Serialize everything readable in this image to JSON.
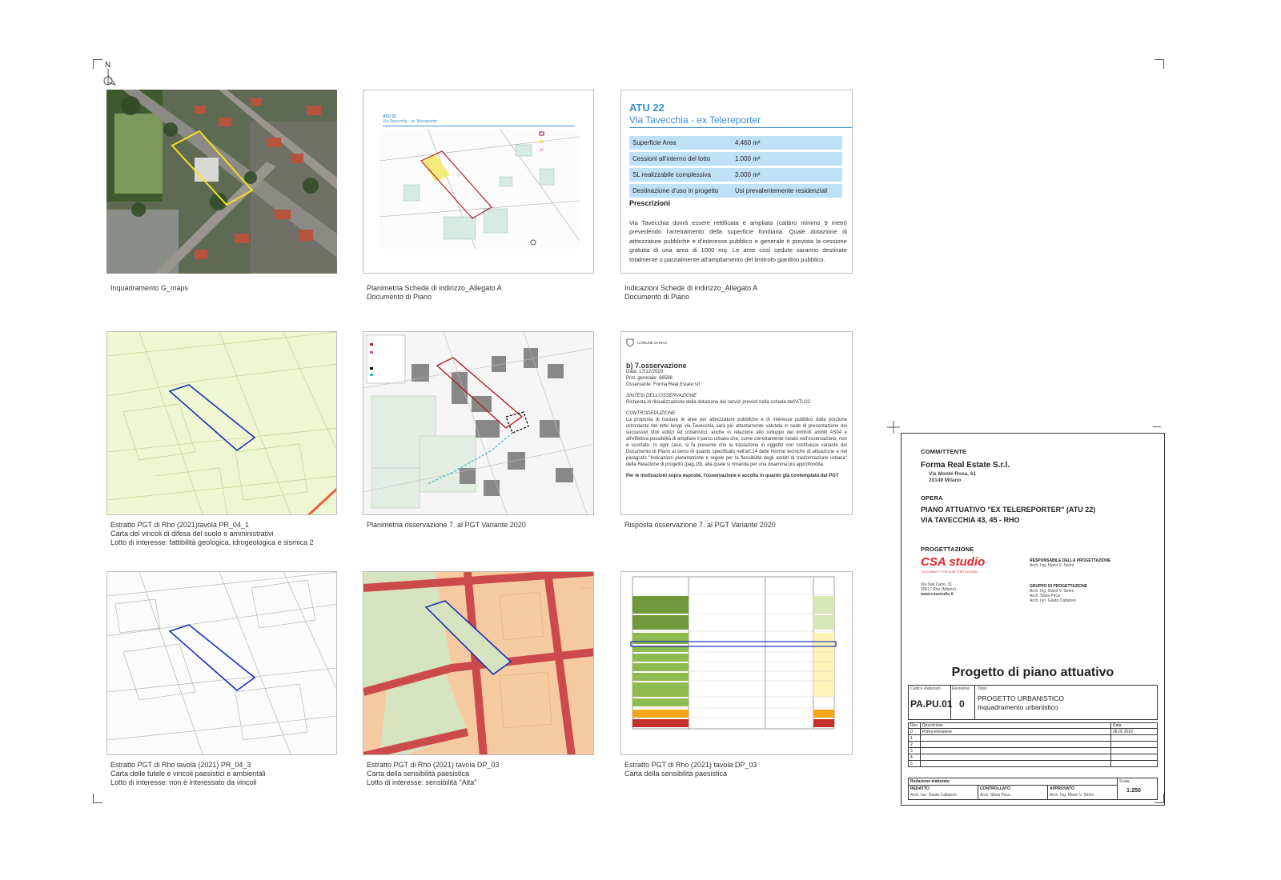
{
  "north": {
    "label": "N"
  },
  "captions": {
    "c1": [
      "Inquadramento G_maps"
    ],
    "c2": [
      "Planimetria Schede di indirizzo_Allegato A",
      "Documento di Piano"
    ],
    "c3": [
      "Indicazioni Schede di indirizzo_Allegato A",
      "Documento di Piano"
    ],
    "c4": [
      "Estratto PGT di Rho (2021)tavola PR_04_1",
      "Carta dei vincoli di difesa del suolo e amministrativi",
      "Lotto di interesse: fattibilità geologica, idrogeologica e sismica 2"
    ],
    "c5": [
      "Planimetria osservazione 7. al PGT Variante 2020"
    ],
    "c6": [
      "Risposta osservazione 7. al PGT Variante 2020"
    ],
    "c7": [
      "Estratto PGT di Rho tavola (2021) PR_04_3",
      "Carta delle tutele e vincoli paesistici e ambientali",
      "Lotto di interesse: non è interessato da vincoli"
    ],
    "c8": [
      "Estratto PGT di Rho (2021) tavola DP_03",
      "Carta della sensibilità paesistica",
      "Lotto di interesse: sensibilità \"Alta\""
    ],
    "c9": [
      "Estratto PGT di Rho (2021) tavola DP_03",
      "Carta della sensibilità paesistica"
    ]
  },
  "atu": {
    "title": "ATU 22",
    "subtitle": "Via Tavecchia - ex Telereporter",
    "rows": [
      {
        "k": "Superficie Area",
        "v": "4.460 m²"
      },
      {
        "k": "Cessioni all'interno del lotto",
        "v": "1.000 m²"
      },
      {
        "k": "SL realizzabile complessiva",
        "v": "3.000 m²"
      },
      {
        "k": "Destinazione d'uso in progetto",
        "v": "Usi prevalentemente residenziali"
      }
    ],
    "prescrizioni_title": "Prescrizioni",
    "prescrizioni_text": "Via Tavecchia dovrà essere rettificata e ampliata (calibro minimo 9 metri) prevedendo l'arretramento della superficie fondiaria. Quale dotazione di attrezzature pubbliche e d'interesse pubblico e generale è prevista la cessione gratuita di una area di 1000 mq. Le aree così cedute saranno destinate totalmente o parzialmente all'ampliamento del limitrofo giardino pubblico."
  },
  "plan_mini": {
    "title": "ATU 22",
    "subtitle": "Via Tavecchia - ex Telereporter"
  },
  "observation": {
    "municipality": "COMUNE DI RHO",
    "title": "b) 7.osservazione",
    "meta": [
      "Data: 17/12/2020",
      "Prot. generale: 68588",
      "Osservante: Forma Real Estate srl"
    ],
    "sintesi_label": "SINTESI DELL'OSSERVAZIONE",
    "sintesi_text": "Richiesta di rilocalizzazione della dotazione dei servizi previsti nella scheda dell'ATU22",
    "contro_label": "CONTRODEDUZIONE",
    "contro_text": "La proposta di traslare le aree per attrezzature pubbliche e di interesse pubblico dalla porzione retrostante del lotto lungo via Tavecchia sarà più attentamente valutata in sede di presentazione dei successivi titoli edilizi ed urbanistici, anche in relazione allo sviluppo dei limitrofi ambiti AS04 e all'effettiva possibilità di ampliare il parco urbano che, come correttamente notato nell'osservazione, non è scontato. In ogni caso, si fa presente che la traslazione in oggetto non costituisce variante del Documento di Piano ai sensi di quanto specificato nell'art.14 delle Norme tecniche di attuazione e nel paragrafo \"Indicazioni planimetriche e regole per la flessibilità degli ambiti di trasformazione urbana\" della Relazione di progetto (pag.19), alla quale si rimanda per una disamina più approfondita.",
    "conclusion": "Per le motivazioni sopra esposte, l'osservazione è accolta in quanto già contemplata dal PGT"
  },
  "title_block": {
    "committente_label": "COMMITTENTE",
    "client_name": "Forma Real Estate S.r.l.",
    "client_addr1": "Via Monte Rosa, 61",
    "client_addr2": "20149 Milano",
    "opera_label": "OPERA",
    "opera_line1": "PIANO ATTUATIVO \"EX TELEREPORTER\" (ATU 22)",
    "opera_line2": "VIA TAVECCHIA 43, 45 - RHO",
    "progettazione_label": "PROGETTAZIONE",
    "studio_logo": "CSA studio",
    "studio_tagline": "ACCURACY FOR A BETTER DESIGN",
    "studio_addr1": "Via San Carlo, 31",
    "studio_addr2": "20017 Rho (Milano)",
    "studio_web": "www.csastudio.it",
    "resp_label": "RESPONSABILE DELLA PROGETTAZIONE",
    "resp_name": "Arch. Ing. Mario V. Serini",
    "gruppo_label": "GRUPPO DI PROGETTAZIONE",
    "gruppo_names": [
      "Arch. Ing. Mario V. Serini",
      "Arch. Silvia Peca",
      "Arch. Iun. Giada Cattaneo"
    ],
    "main_title": "Progetto di piano attuativo",
    "codice_label": "Codice elaborato",
    "revisione_label": "Revisione",
    "titolo_label": "Titolo",
    "codice": "PA.PU.01",
    "revisione": "0",
    "titolo1": "PROGETTO URBANISTICO",
    "titolo2": "Inquadramento urbanistico",
    "rev_header": {
      "rev": "Rev.",
      "desc": "Descrizione",
      "date": "Data"
    },
    "revs": [
      {
        "n": "0",
        "d": "Prima emissione",
        "date": "28.02.2022"
      },
      {
        "n": "1",
        "d": "",
        "date": ""
      },
      {
        "n": "2",
        "d": "",
        "date": ""
      },
      {
        "n": "3",
        "d": "",
        "date": ""
      },
      {
        "n": "4",
        "d": "",
        "date": ""
      },
      {
        "n": "5",
        "d": "",
        "date": ""
      }
    ],
    "redazione_label": "Redazione elaborato",
    "scala_label": "Scala",
    "redatto_label": "REDATTO",
    "controllato_label": "CONTROLLATO",
    "approvato_label": "APPROVATO",
    "redatto": "Arch. Iun. Giada Cattaneo",
    "controllato": "Arch. Silvia Peca",
    "approvato": "Arch. Ing. Mario V. Serini",
    "scala": "1:250"
  },
  "colors": {
    "boundary_red": "#b0202a",
    "boundary_blue": "#1a2fb8",
    "accent_blue": "#3a8fd6",
    "logo_red": "#e3252b"
  }
}
